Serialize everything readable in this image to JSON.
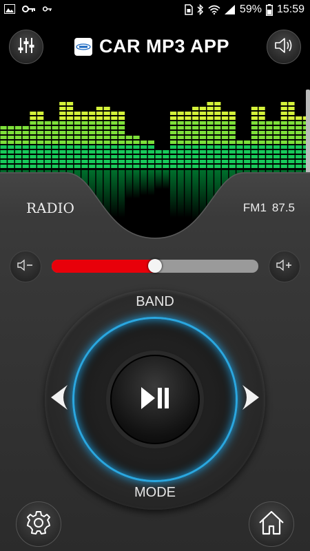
{
  "status_bar": {
    "icons_left": [
      "image-icon",
      "key-icon",
      "key-small-icon"
    ],
    "icons_right": [
      "sim-icon",
      "bluetooth-icon",
      "wifi-icon",
      "signal-icon",
      "battery-icon"
    ],
    "battery": "59%",
    "time": "15:59"
  },
  "header": {
    "title": "CAR MP3 APP",
    "left_button_icon": "equalizer-sliders-icon",
    "right_button_icon": "speaker-icon"
  },
  "visualizer": {
    "levels": [
      0.55,
      0.55,
      0.55,
      0.55,
      0.75,
      0.75,
      0.65,
      0.65,
      0.9,
      0.9,
      0.75,
      0.75,
      0.75,
      0.8,
      0.8,
      0.75,
      0.75,
      0.45,
      0.45,
      0.4,
      0.4,
      0.3,
      0.3,
      0.75,
      0.75,
      0.75,
      0.8,
      0.8,
      0.9,
      0.9,
      0.75,
      0.75,
      0.4,
      0.4,
      0.8,
      0.8,
      0.65,
      0.65,
      0.9,
      0.9,
      0.7,
      0.7
    ],
    "colors": {
      "top": "#d4f23a",
      "bottom": "#00c853"
    }
  },
  "source": {
    "label": "RADIO",
    "band": "FM1",
    "frequency": "87.5"
  },
  "volume": {
    "level": 0.5,
    "down_icon": "volume-down-icon",
    "up_icon": "volume-up-icon",
    "fill_color": "#e8000a"
  },
  "dial": {
    "band_label": "BAND",
    "mode_label": "MODE",
    "ring_color": "#2aa7e0",
    "center_icon": "play-pause-icon",
    "left_icon": "previous-arrow-icon",
    "right_icon": "next-arrow-icon"
  },
  "footer": {
    "settings_icon": "gear-icon",
    "home_icon": "home-icon"
  }
}
